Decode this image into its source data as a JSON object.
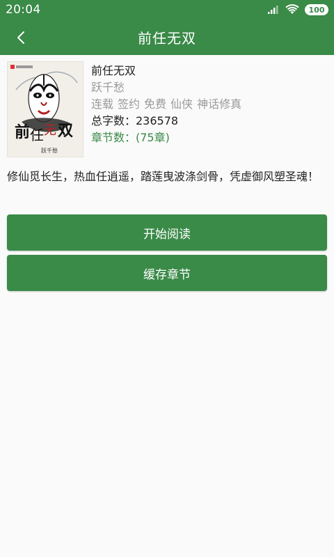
{
  "status": {
    "time": "20:04",
    "battery": "100",
    "icons": [
      "signal-icon",
      "wifi-icon",
      "battery-icon"
    ]
  },
  "appbar": {
    "title": "前任无双",
    "back_icon": "back-icon"
  },
  "book": {
    "title": "前任无双",
    "author": "跃千愁",
    "tags": [
      "连载",
      "签约",
      "免费",
      "仙侠",
      "神话修真"
    ],
    "word_count": "总字数：236578",
    "chapters": "章节数：(75章)",
    "cover": {
      "title": "前任无双",
      "author": "跃千愁"
    }
  },
  "description": "修仙觅长生，热血任逍遥，踏莲曳波涤剑骨，凭虚御风塑圣魂！",
  "buttons": {
    "read": "开始阅读",
    "cache": "缓存章节"
  },
  "colors": {
    "primary": "#3a8a48",
    "background": "#fafafa"
  }
}
